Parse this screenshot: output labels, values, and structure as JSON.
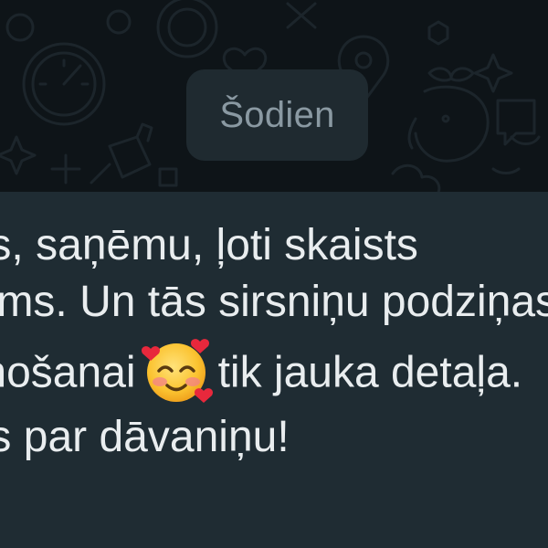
{
  "chat": {
    "date_separator": "Šodien",
    "message": {
      "line1": "Paldies, saņēmu, ļoti skaists",
      "line2": "pakojums. Un tās sirsniņu podziņas",
      "line3_before": "pievienošanai",
      "line3_after": "tik jauka detaļa.",
      "line4": "Paldies par dāvaniņu!",
      "emoji": "smiling-face-with-hearts-icon"
    }
  },
  "colors": {
    "wallpaper": "#0e1418",
    "date_chip_bg": "#1f2a30",
    "date_chip_text": "#8a99a2",
    "bubble_bg": "#1f2c33",
    "message_text": "#e9edef"
  }
}
